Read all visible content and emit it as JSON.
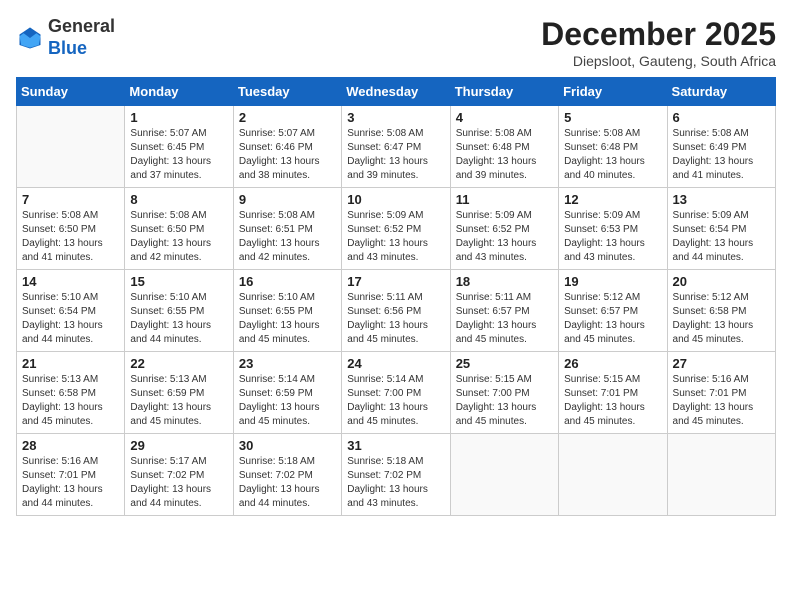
{
  "header": {
    "logo_line1": "General",
    "logo_line2": "Blue",
    "month": "December 2025",
    "location": "Diepsloot, Gauteng, South Africa"
  },
  "weekdays": [
    "Sunday",
    "Monday",
    "Tuesday",
    "Wednesday",
    "Thursday",
    "Friday",
    "Saturday"
  ],
  "weeks": [
    [
      {
        "day": "",
        "text": ""
      },
      {
        "day": "1",
        "text": "Sunrise: 5:07 AM\nSunset: 6:45 PM\nDaylight: 13 hours\nand 37 minutes."
      },
      {
        "day": "2",
        "text": "Sunrise: 5:07 AM\nSunset: 6:46 PM\nDaylight: 13 hours\nand 38 minutes."
      },
      {
        "day": "3",
        "text": "Sunrise: 5:08 AM\nSunset: 6:47 PM\nDaylight: 13 hours\nand 39 minutes."
      },
      {
        "day": "4",
        "text": "Sunrise: 5:08 AM\nSunset: 6:48 PM\nDaylight: 13 hours\nand 39 minutes."
      },
      {
        "day": "5",
        "text": "Sunrise: 5:08 AM\nSunset: 6:48 PM\nDaylight: 13 hours\nand 40 minutes."
      },
      {
        "day": "6",
        "text": "Sunrise: 5:08 AM\nSunset: 6:49 PM\nDaylight: 13 hours\nand 41 minutes."
      }
    ],
    [
      {
        "day": "7",
        "text": "Sunrise: 5:08 AM\nSunset: 6:50 PM\nDaylight: 13 hours\nand 41 minutes."
      },
      {
        "day": "8",
        "text": "Sunrise: 5:08 AM\nSunset: 6:50 PM\nDaylight: 13 hours\nand 42 minutes."
      },
      {
        "day": "9",
        "text": "Sunrise: 5:08 AM\nSunset: 6:51 PM\nDaylight: 13 hours\nand 42 minutes."
      },
      {
        "day": "10",
        "text": "Sunrise: 5:09 AM\nSunset: 6:52 PM\nDaylight: 13 hours\nand 43 minutes."
      },
      {
        "day": "11",
        "text": "Sunrise: 5:09 AM\nSunset: 6:52 PM\nDaylight: 13 hours\nand 43 minutes."
      },
      {
        "day": "12",
        "text": "Sunrise: 5:09 AM\nSunset: 6:53 PM\nDaylight: 13 hours\nand 43 minutes."
      },
      {
        "day": "13",
        "text": "Sunrise: 5:09 AM\nSunset: 6:54 PM\nDaylight: 13 hours\nand 44 minutes."
      }
    ],
    [
      {
        "day": "14",
        "text": "Sunrise: 5:10 AM\nSunset: 6:54 PM\nDaylight: 13 hours\nand 44 minutes."
      },
      {
        "day": "15",
        "text": "Sunrise: 5:10 AM\nSunset: 6:55 PM\nDaylight: 13 hours\nand 44 minutes."
      },
      {
        "day": "16",
        "text": "Sunrise: 5:10 AM\nSunset: 6:55 PM\nDaylight: 13 hours\nand 45 minutes."
      },
      {
        "day": "17",
        "text": "Sunrise: 5:11 AM\nSunset: 6:56 PM\nDaylight: 13 hours\nand 45 minutes."
      },
      {
        "day": "18",
        "text": "Sunrise: 5:11 AM\nSunset: 6:57 PM\nDaylight: 13 hours\nand 45 minutes."
      },
      {
        "day": "19",
        "text": "Sunrise: 5:12 AM\nSunset: 6:57 PM\nDaylight: 13 hours\nand 45 minutes."
      },
      {
        "day": "20",
        "text": "Sunrise: 5:12 AM\nSunset: 6:58 PM\nDaylight: 13 hours\nand 45 minutes."
      }
    ],
    [
      {
        "day": "21",
        "text": "Sunrise: 5:13 AM\nSunset: 6:58 PM\nDaylight: 13 hours\nand 45 minutes."
      },
      {
        "day": "22",
        "text": "Sunrise: 5:13 AM\nSunset: 6:59 PM\nDaylight: 13 hours\nand 45 minutes."
      },
      {
        "day": "23",
        "text": "Sunrise: 5:14 AM\nSunset: 6:59 PM\nDaylight: 13 hours\nand 45 minutes."
      },
      {
        "day": "24",
        "text": "Sunrise: 5:14 AM\nSunset: 7:00 PM\nDaylight: 13 hours\nand 45 minutes."
      },
      {
        "day": "25",
        "text": "Sunrise: 5:15 AM\nSunset: 7:00 PM\nDaylight: 13 hours\nand 45 minutes."
      },
      {
        "day": "26",
        "text": "Sunrise: 5:15 AM\nSunset: 7:01 PM\nDaylight: 13 hours\nand 45 minutes."
      },
      {
        "day": "27",
        "text": "Sunrise: 5:16 AM\nSunset: 7:01 PM\nDaylight: 13 hours\nand 45 minutes."
      }
    ],
    [
      {
        "day": "28",
        "text": "Sunrise: 5:16 AM\nSunset: 7:01 PM\nDaylight: 13 hours\nand 44 minutes."
      },
      {
        "day": "29",
        "text": "Sunrise: 5:17 AM\nSunset: 7:02 PM\nDaylight: 13 hours\nand 44 minutes."
      },
      {
        "day": "30",
        "text": "Sunrise: 5:18 AM\nSunset: 7:02 PM\nDaylight: 13 hours\nand 44 minutes."
      },
      {
        "day": "31",
        "text": "Sunrise: 5:18 AM\nSunset: 7:02 PM\nDaylight: 13 hours\nand 43 minutes."
      },
      {
        "day": "",
        "text": ""
      },
      {
        "day": "",
        "text": ""
      },
      {
        "day": "",
        "text": ""
      }
    ]
  ]
}
